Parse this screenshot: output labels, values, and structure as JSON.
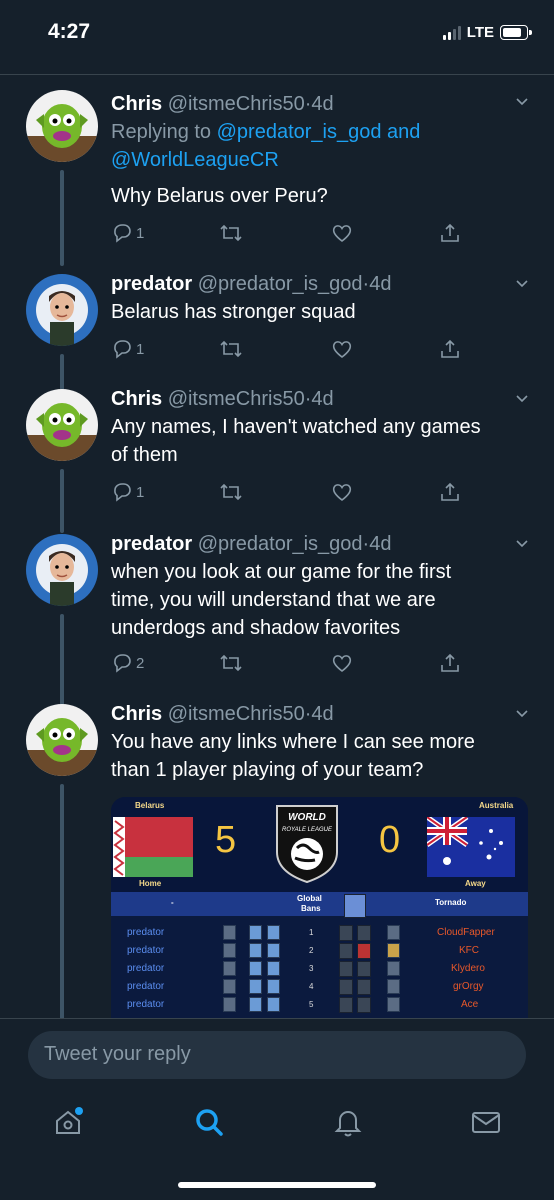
{
  "status": {
    "time": "4:27",
    "network": "LTE"
  },
  "tweets": [
    {
      "name": "Chris",
      "handle": "@itsmeChris50",
      "time": "4d",
      "reply_prefix": "Replying to ",
      "reply_to_1": "@predator_is_god",
      "reply_and": " and ",
      "reply_to_2": "@WorldLeagueCR",
      "text": "Why Belarus over Peru?",
      "replies": "1"
    },
    {
      "name": "predator",
      "handle": "@predator_is_god",
      "time": "4d",
      "text": "Belarus has stronger squad",
      "replies": "1"
    },
    {
      "name": "Chris",
      "handle": "@itsmeChris50",
      "time": "4d",
      "text_line1": "Any names, I haven't watched any games",
      "text_line2": "of them",
      "replies": "1"
    },
    {
      "name": "predator",
      "handle": "@predator_is_god",
      "time": "4d",
      "text_line1": "when you look at our game for the first",
      "text_line2": "time, you will understand that we are",
      "text_line3": "underdogs and shadow favorites",
      "replies": "2"
    },
    {
      "name": "Chris",
      "handle": "@itsmeChris50",
      "time": "4d",
      "text_line1": "You have any links where I can see more",
      "text_line2": "than 1 player playing of your team?"
    }
  ],
  "media": {
    "left_country": "Belarus",
    "right_country": "Australia",
    "left_score": "5",
    "right_score": "0",
    "logo_line1": "WORLD",
    "logo_line2": "ROYALE LEAGUE",
    "home_label": "Home",
    "away_label": "Away",
    "left_team": "-",
    "global_bans_1": "Global",
    "global_bans_2": "Bans",
    "right_team": "Tornado",
    "rows": [
      {
        "left": "predator",
        "num": "1",
        "right": "CloudFapper"
      },
      {
        "left": "predator",
        "num": "2",
        "right": "KFC"
      },
      {
        "left": "predator",
        "num": "3",
        "right": "Klydero"
      },
      {
        "left": "predator",
        "num": "4",
        "right": "grOrgy"
      },
      {
        "left": "predator",
        "num": "5",
        "right": "Ace"
      }
    ]
  },
  "reply_placeholder": "Tweet your reply",
  "icons": {
    "reply": "reply-icon",
    "retweet": "retweet-icon",
    "like": "heart-icon",
    "share": "share-icon",
    "home": "home-icon",
    "search": "search-icon",
    "notifications": "bell-icon",
    "messages": "mail-icon"
  },
  "colors": {
    "background": "#15202b",
    "accent": "#1da1f2",
    "muted": "#8899a6"
  }
}
